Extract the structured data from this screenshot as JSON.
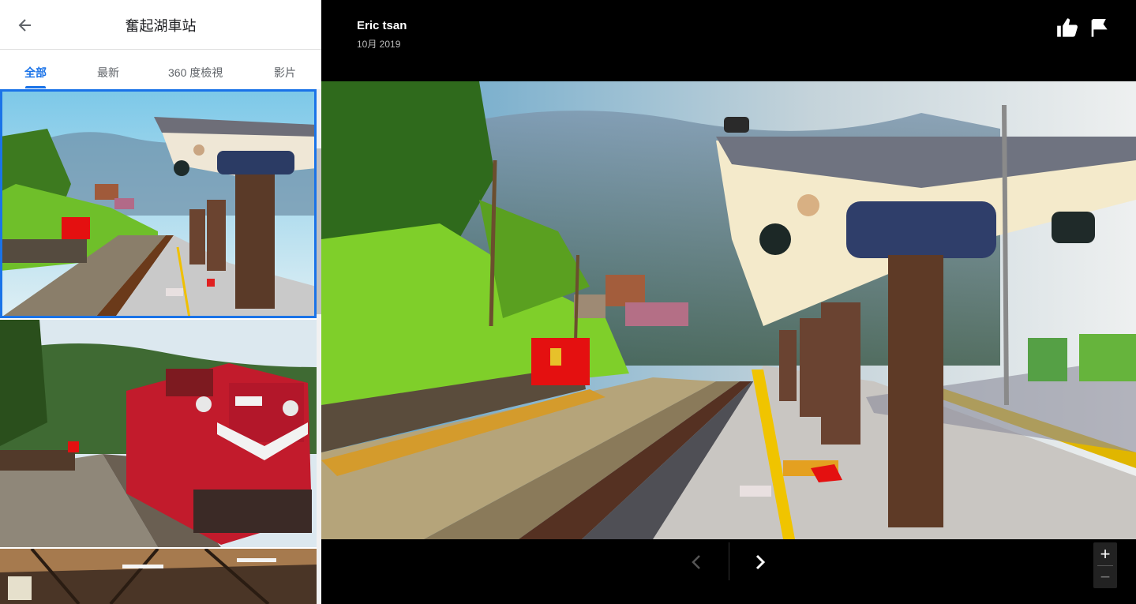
{
  "panel": {
    "title": "奮起湖車站",
    "back_icon": "arrow-left-icon",
    "tabs": [
      {
        "label": "全部",
        "active": true
      },
      {
        "label": "最新",
        "active": false
      },
      {
        "label": "360 度檢視",
        "active": false
      },
      {
        "label": "影片",
        "active": false
      }
    ],
    "accent": "#1a73e8"
  },
  "viewer": {
    "author": "Eric tsan",
    "date": "10月 2019",
    "like_icon": "thumbs-up-icon",
    "flag_icon": "flag-icon",
    "zoom_in": "+",
    "zoom_out": "−",
    "prev_icon": "chevron-left-icon",
    "next_icon": "chevron-right-icon"
  }
}
